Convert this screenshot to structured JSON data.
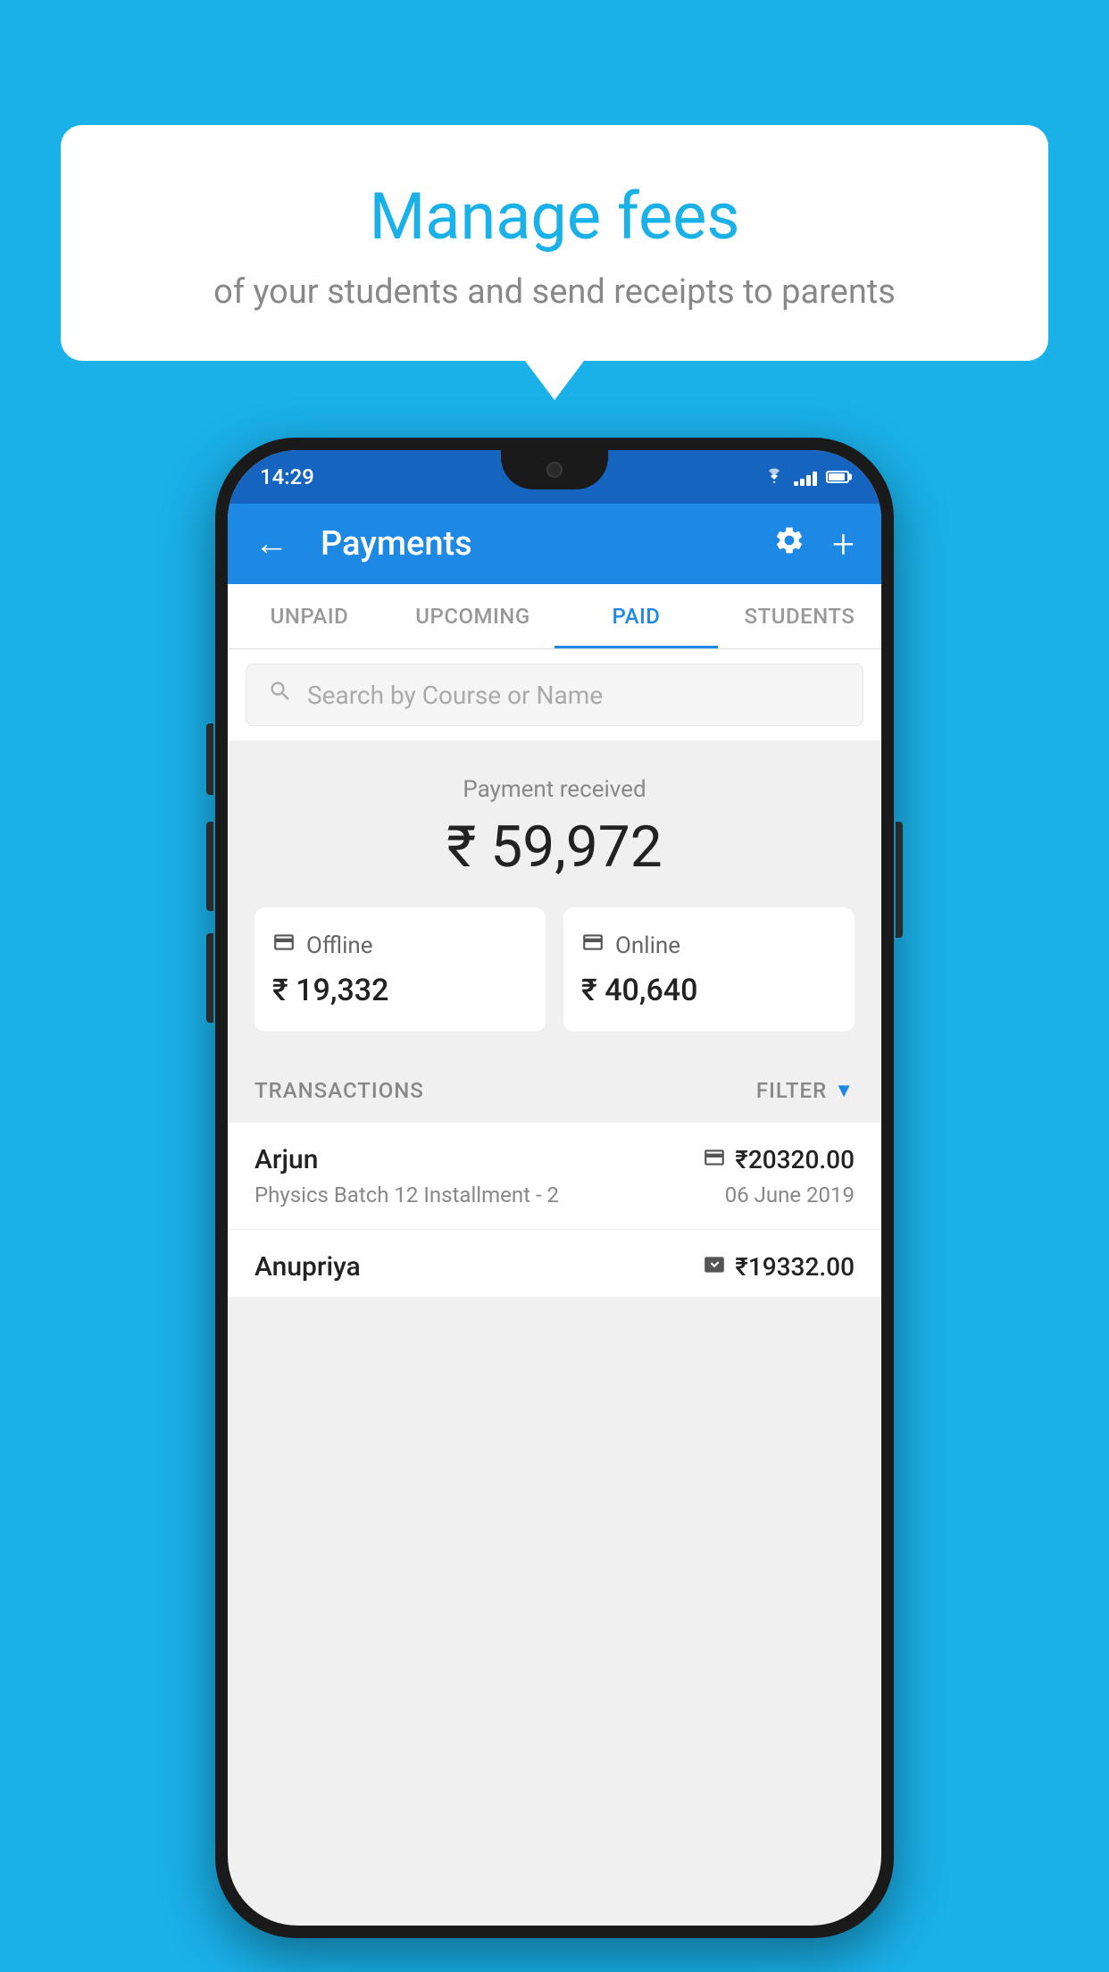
{
  "background_color": "#1ab0e8",
  "speech_bubble": {
    "title": "Manage fees",
    "subtitle": "of your students and send receipts to parents"
  },
  "phone": {
    "status_bar": {
      "time": "14:29",
      "wifi": "▲",
      "signal_bars": [
        4,
        7,
        10,
        13,
        16
      ],
      "battery_percent": 70
    },
    "app_bar": {
      "back_label": "←",
      "title": "Payments",
      "gear_label": "⚙",
      "plus_label": "+"
    },
    "tabs": [
      {
        "label": "UNPAID",
        "active": false
      },
      {
        "label": "UPCOMING",
        "active": false
      },
      {
        "label": "PAID",
        "active": true
      },
      {
        "label": "STUDENTS",
        "active": false
      }
    ],
    "search": {
      "placeholder": "Search by Course or Name"
    },
    "payment_summary": {
      "label": "Payment received",
      "amount": "₹ 59,972",
      "cards": [
        {
          "icon": "offline",
          "label": "Offline",
          "amount": "₹ 19,332"
        },
        {
          "icon": "online",
          "label": "Online",
          "amount": "₹ 40,640"
        }
      ]
    },
    "transactions": {
      "label": "TRANSACTIONS",
      "filter_label": "FILTER",
      "rows": [
        {
          "name": "Arjun",
          "payment_method": "online",
          "amount": "₹20320.00",
          "course": "Physics Batch 12 Installment - 2",
          "date": "06 June 2019"
        },
        {
          "name": "Anupriya",
          "payment_method": "offline",
          "amount": "₹19332.00",
          "course": "",
          "date": ""
        }
      ]
    }
  }
}
